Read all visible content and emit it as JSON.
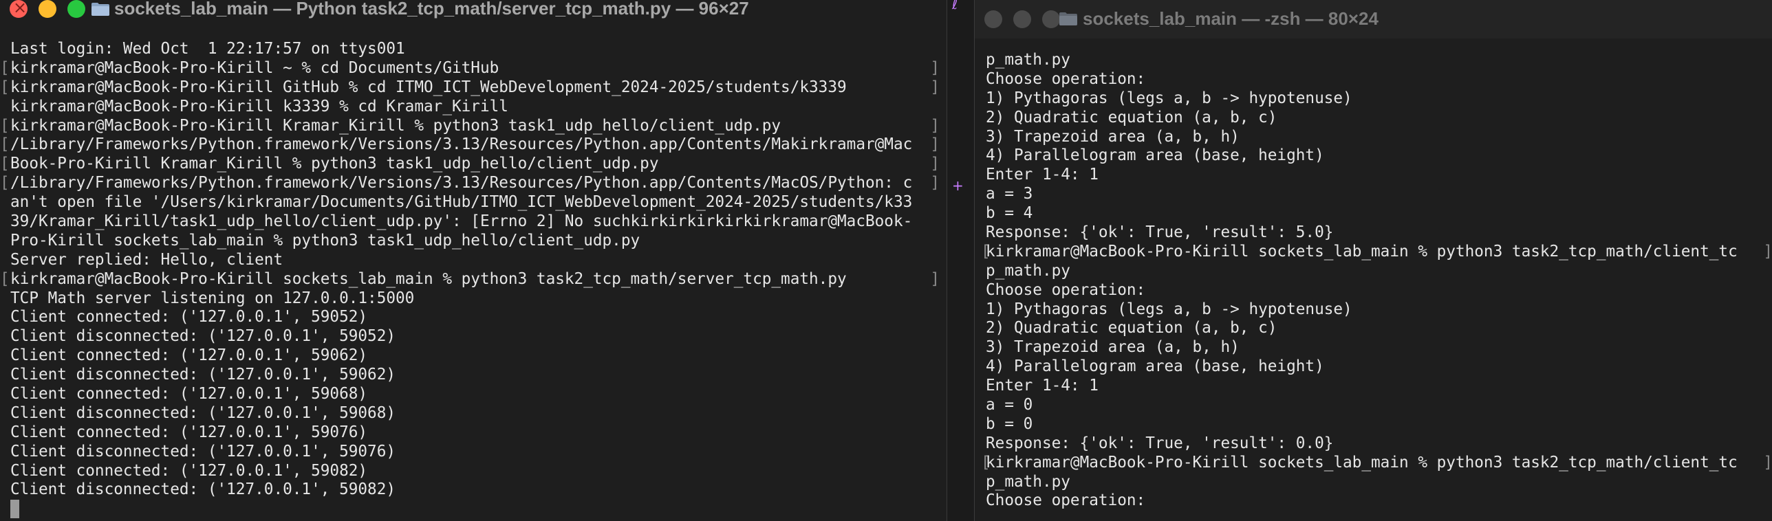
{
  "left_window": {
    "title": "sockets_lab_main — Python task2_tcp_math/server_tcp_math.py — 96×27",
    "lines": [
      {
        "text": "Last login: Wed Oct  1 22:17:57 on ttys001",
        "bracket": false
      },
      {
        "text": "kirkramar@MacBook-Pro-Kirill ~ % cd Documents/GitHub",
        "bracket": true
      },
      {
        "text": "kirkramar@MacBook-Pro-Kirill GitHub % cd ITMO_ICT_WebDevelopment_2024-2025/students/k3339",
        "bracket": true
      },
      {
        "text": "kirkramar@MacBook-Pro-Kirill k3339 % cd Kramar_Kirill",
        "bracket": false
      },
      {
        "text": "kirkramar@MacBook-Pro-Kirill Kramar_Kirill % python3 task1_udp_hello/client_udp.py",
        "bracket": true
      },
      {
        "text": "/Library/Frameworks/Python.framework/Versions/3.13/Resources/Python.app/Contents/Makirkramar@Mac",
        "bracket": true
      },
      {
        "text": "Book-Pro-Kirill Kramar_Kirill % python3 task1_udp_hello/client_udp.py",
        "bracket": true
      },
      {
        "text": "/Library/Frameworks/Python.framework/Versions/3.13/Resources/Python.app/Contents/MacOS/Python: c",
        "bracket": true
      },
      {
        "text": "an't open file '/Users/kirkramar/Documents/GitHub/ITMO_ICT_WebDevelopment_2024-2025/students/k33",
        "bracket": false
      },
      {
        "text": "39/Kramar_Kirill/task1_udp_hello/client_udp.py': [Errno 2] No suchkirkirkirkirkirkramar@MacBook-",
        "bracket": false
      },
      {
        "text": "Pro-Kirill sockets_lab_main % python3 task1_udp_hello/client_udp.py",
        "bracket": false
      },
      {
        "text": "Server replied: Hello, client",
        "bracket": false
      },
      {
        "text": "kirkramar@MacBook-Pro-Kirill sockets_lab_main % python3 task2_tcp_math/server_tcp_math.py",
        "bracket": true
      },
      {
        "text": "TCP Math server listening on 127.0.0.1:5000",
        "bracket": false
      },
      {
        "text": "Client connected: ('127.0.0.1', 59052)",
        "bracket": false
      },
      {
        "text": "Client disconnected: ('127.0.0.1', 59052)",
        "bracket": false
      },
      {
        "text": "Client connected: ('127.0.0.1', 59062)",
        "bracket": false
      },
      {
        "text": "Client disconnected: ('127.0.0.1', 59062)",
        "bracket": false
      },
      {
        "text": "Client connected: ('127.0.0.1', 59068)",
        "bracket": false
      },
      {
        "text": "Client disconnected: ('127.0.0.1', 59068)",
        "bracket": false
      },
      {
        "text": "Client connected: ('127.0.0.1', 59076)",
        "bracket": false
      },
      {
        "text": "Client disconnected: ('127.0.0.1', 59076)",
        "bracket": false
      },
      {
        "text": "Client connected: ('127.0.0.1', 59082)",
        "bracket": false
      },
      {
        "text": "Client disconnected: ('127.0.0.1', 59082)",
        "bracket": false
      }
    ]
  },
  "right_window": {
    "title": "sockets_lab_main — -zsh — 80×24",
    "lines": [
      {
        "text": "p_math.py",
        "bracket": false
      },
      {
        "text": "Choose operation:",
        "bracket": false
      },
      {
        "text": "1) Pythagoras (legs a, b -> hypotenuse)",
        "bracket": false
      },
      {
        "text": "2) Quadratic equation (a, b, c)",
        "bracket": false
      },
      {
        "text": "3) Trapezoid area (a, b, h)",
        "bracket": false
      },
      {
        "text": "4) Parallelogram area (base, height)",
        "bracket": false
      },
      {
        "text": "Enter 1-4: 1",
        "bracket": false
      },
      {
        "text": "a = 3",
        "bracket": false
      },
      {
        "text": "b = 4",
        "bracket": false
      },
      {
        "text": "Response: {'ok': True, 'result': 5.0}",
        "bracket": false
      },
      {
        "text": "kirkramar@MacBook-Pro-Kirill sockets_lab_main % python3 task2_tcp_math/client_tc",
        "bracket": true
      },
      {
        "text": "p_math.py",
        "bracket": false
      },
      {
        "text": "Choose operation:",
        "bracket": false
      },
      {
        "text": "1) Pythagoras (legs a, b -> hypotenuse)",
        "bracket": false
      },
      {
        "text": "2) Quadratic equation (a, b, c)",
        "bracket": false
      },
      {
        "text": "3) Trapezoid area (a, b, h)",
        "bracket": false
      },
      {
        "text": "4) Parallelogram area (base, height)",
        "bracket": false
      },
      {
        "text": "Enter 1-4: 1",
        "bracket": false
      },
      {
        "text": "a = 0",
        "bracket": false
      },
      {
        "text": "b = 0",
        "bracket": false
      },
      {
        "text": "Response: {'ok': True, 'result': 0.0}",
        "bracket": false
      },
      {
        "text": "kirkramar@MacBook-Pro-Kirill sockets_lab_main % python3 task2_tcp_math/client_tc",
        "bracket": true
      },
      {
        "text": "p_math.py",
        "bracket": false
      },
      {
        "text": "Choose operation:",
        "bracket": false
      }
    ]
  },
  "gap_marks": [
    {
      "text": "ℓ",
      "color": "#c77dff"
    },
    {
      "text": "+",
      "color": "#c77dff"
    }
  ],
  "colors": {
    "terminal_bg": "#1e1e1e",
    "terminal_fg": "#e6e6e6",
    "close": "#ff5f57",
    "minimize": "#febc2e",
    "zoom": "#28c840",
    "inactive_light": "#4a4a4a"
  }
}
